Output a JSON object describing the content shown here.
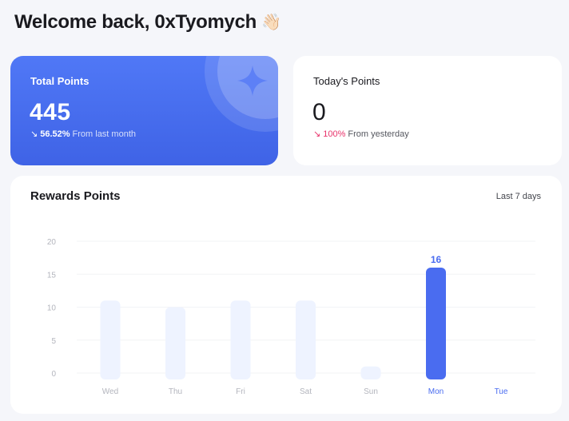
{
  "header": {
    "welcome_text": "Welcome back, 0xTyomych",
    "wave_icon": "👋🏻"
  },
  "total_points": {
    "label": "Total Points",
    "value": "445",
    "trend_arrow": "↘",
    "trend_percent": "56.52%",
    "trend_text": "From last month",
    "icon": "sparkle-icon"
  },
  "todays_points": {
    "label": "Today's Points",
    "value": "0",
    "trend_arrow": "↘",
    "trend_percent": "100%",
    "trend_text": "From yesterday"
  },
  "rewards": {
    "title": "Rewards Points",
    "range": "Last 7 days"
  },
  "colors": {
    "accent": "#4a6cf0",
    "bar_muted": "#eef3ff",
    "negative": "#e8336b"
  },
  "chart_data": {
    "type": "bar",
    "categories": [
      "Wed",
      "Thu",
      "Fri",
      "Sat",
      "Sun",
      "Mon",
      "Tue"
    ],
    "values": [
      11,
      10,
      11,
      11,
      1,
      16,
      0
    ],
    "highlighted_categories": [
      "Mon",
      "Tue"
    ],
    "data_labels": [
      {
        "category": "Mon",
        "text": "16"
      }
    ],
    "yticks": [
      0,
      5,
      10,
      15,
      20
    ],
    "ylim": [
      0,
      20
    ],
    "grid": true,
    "title": "Rewards Points",
    "xlabel": "",
    "ylabel": ""
  }
}
